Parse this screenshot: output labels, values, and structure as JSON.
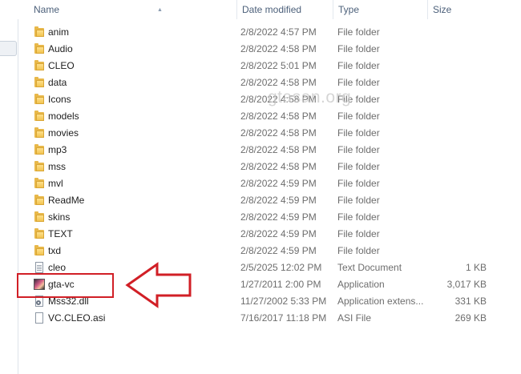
{
  "header": {
    "columns": {
      "name": "Name",
      "date": "Date modified",
      "type": "Type",
      "size": "Size"
    }
  },
  "watermark": "gtasan.org",
  "files": [
    {
      "name": "anim",
      "date": "2/8/2022 4:57 PM",
      "type": "File folder",
      "size": "",
      "icon": "folder-icon"
    },
    {
      "name": "Audio",
      "date": "2/8/2022 4:58 PM",
      "type": "File folder",
      "size": "",
      "icon": "folder-icon"
    },
    {
      "name": "CLEO",
      "date": "2/8/2022 5:01 PM",
      "type": "File folder",
      "size": "",
      "icon": "folder-icon"
    },
    {
      "name": "data",
      "date": "2/8/2022 4:58 PM",
      "type": "File folder",
      "size": "",
      "icon": "folder-icon"
    },
    {
      "name": "Icons",
      "date": "2/8/2022 4:58 PM",
      "type": "File folder",
      "size": "",
      "icon": "folder-icon"
    },
    {
      "name": "models",
      "date": "2/8/2022 4:58 PM",
      "type": "File folder",
      "size": "",
      "icon": "folder-icon"
    },
    {
      "name": "movies",
      "date": "2/8/2022 4:58 PM",
      "type": "File folder",
      "size": "",
      "icon": "folder-icon"
    },
    {
      "name": "mp3",
      "date": "2/8/2022 4:58 PM",
      "type": "File folder",
      "size": "",
      "icon": "folder-icon"
    },
    {
      "name": "mss",
      "date": "2/8/2022 4:58 PM",
      "type": "File folder",
      "size": "",
      "icon": "folder-icon"
    },
    {
      "name": "mvl",
      "date": "2/8/2022 4:59 PM",
      "type": "File folder",
      "size": "",
      "icon": "folder-icon"
    },
    {
      "name": "ReadMe",
      "date": "2/8/2022 4:59 PM",
      "type": "File folder",
      "size": "",
      "icon": "folder-icon"
    },
    {
      "name": "skins",
      "date": "2/8/2022 4:59 PM",
      "type": "File folder",
      "size": "",
      "icon": "folder-icon"
    },
    {
      "name": "TEXT",
      "date": "2/8/2022 4:59 PM",
      "type": "File folder",
      "size": "",
      "icon": "folder-icon"
    },
    {
      "name": "txd",
      "date": "2/8/2022 4:59 PM",
      "type": "File folder",
      "size": "",
      "icon": "folder-icon"
    },
    {
      "name": "cleo",
      "date": "2/5/2025 12:02 PM",
      "type": "Text Document",
      "size": "1 KB",
      "icon": "text-document-icon"
    },
    {
      "name": "gta-vc",
      "date": "1/27/2011 2:00 PM",
      "type": "Application",
      "size": "3,017 KB",
      "icon": "application-icon"
    },
    {
      "name": "Mss32.dll",
      "date": "11/27/2002 5:33 PM",
      "type": "Application extens...",
      "size": "331 KB",
      "icon": "dll-icon"
    },
    {
      "name": "VC.CLEO.asi",
      "date": "7/16/2017 11:18 PM",
      "type": "ASI File",
      "size": "269 KB",
      "icon": "file-icon"
    }
  ],
  "colors": {
    "highlight": "#d11f26",
    "header_text": "#4c607a",
    "folder": "#f2c451"
  }
}
